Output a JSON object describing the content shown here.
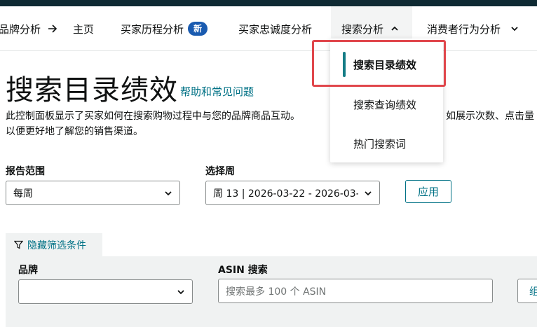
{
  "nav": {
    "brand_analytics": "品牌分析",
    "home": "主页",
    "buyer_journey": "买家历程分析",
    "new_badge": "新",
    "loyalty": "买家忠诚度分析",
    "search_analytics": "搜索分析",
    "consumer_behavior": "消费者行为分析"
  },
  "dropdown": {
    "items": [
      {
        "label": "搜索目录绩效",
        "active": true
      },
      {
        "label": "搜索查询绩效",
        "active": false
      },
      {
        "label": "热门搜索词",
        "active": false
      }
    ]
  },
  "page": {
    "title": "搜索目录绩效",
    "help_link": "帮助和常见问题",
    "description_line1": "此控制面板显示了买家如何在搜索购物过程中与您的品牌商品互动。",
    "description_tail": "如展示次数、点击量",
    "description_line2": "以便更好地了解您的销售渠道。"
  },
  "filters": {
    "report_range_label": "报告范围",
    "report_range_value": "每周",
    "select_week_label": "选择周",
    "select_week_value": "周 13 | 2026-03-22 - 2026-03-",
    "apply_button": "应用",
    "hide_filters": "隐藏筛选条件",
    "brand_label": "品牌",
    "brand_value": "",
    "asin_search_label": "ASIN 搜索",
    "asin_placeholder": "搜索最多 100 个 ASIN",
    "partial_button": "组"
  },
  "colors": {
    "accent_teal": "#007185",
    "badge_blue": "#1a5bb0",
    "highlight_red": "#e0474c",
    "top_bar": "#0f2a33"
  }
}
